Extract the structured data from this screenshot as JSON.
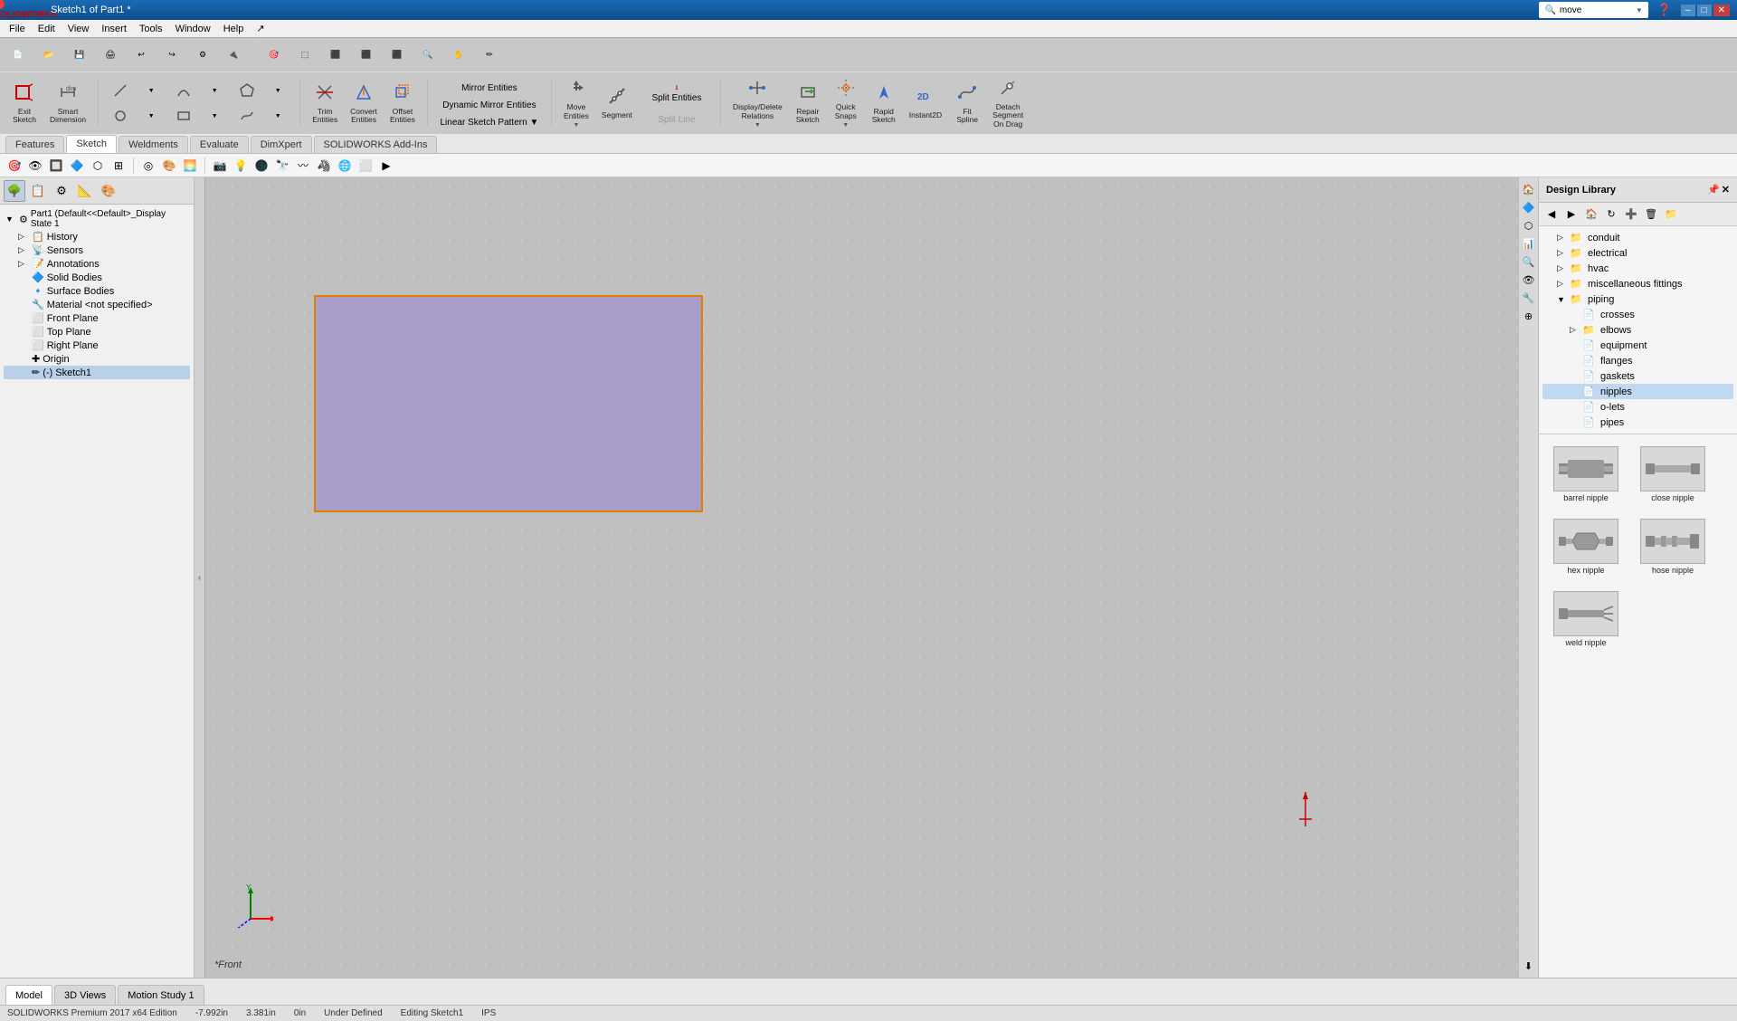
{
  "titlebar": {
    "logo": "SW",
    "title": "Sketch1 of Part1 *",
    "search_placeholder": "move",
    "controls": [
      "–",
      "□",
      "✕"
    ]
  },
  "menubar": {
    "items": [
      "File",
      "Edit",
      "View",
      "Insert",
      "Tools",
      "Window",
      "Help",
      "↗"
    ]
  },
  "toolbar": {
    "row1_icons": [
      "new",
      "open",
      "save",
      "print",
      "undo",
      "redo",
      "options"
    ],
    "sketch_tools": {
      "exit_sketch": "Exit\nSketch",
      "smart_dimension": "Smart\nDimension",
      "trim_entities": "Trim\nEntities",
      "convert_entities": "Convert\nEntities",
      "offset_entities": "Offset\nEntities",
      "mirror_entities": "Mirror Entities",
      "dynamic_mirror": "Dynamic Mirror Entities",
      "linear_pattern": "Linear Sketch Pattern",
      "move_entities": "Move Entities",
      "segment": "Segment",
      "split_line": "Split Line",
      "split_entities": "Split Entities",
      "display_delete": "Display/Delete\nRelations",
      "repair_sketch": "Repair\nSketch",
      "quick_snaps": "Quick\nSnaps",
      "rapid_sketch": "Rapid\nSketch",
      "instant2d": "Instant2D",
      "fit_spline": "Fit\nSpline",
      "detach_segment": "Detach\nSegment\nOn Drag"
    }
  },
  "tabs": {
    "items": [
      "Features",
      "Sketch",
      "Weldments",
      "Evaluate",
      "DimXpert",
      "SOLIDWORKS Add-Ins"
    ]
  },
  "left_panel": {
    "tab_icons": [
      "tree",
      "props",
      "config",
      "display",
      "appear"
    ],
    "tree": {
      "root": "Part1 (Default<<Default>_Display State 1",
      "items": [
        {
          "level": 1,
          "icon": "📋",
          "label": "History",
          "expand": false
        },
        {
          "level": 1,
          "icon": "📡",
          "label": "Sensors",
          "expand": false
        },
        {
          "level": 1,
          "icon": "📝",
          "label": "Annotations",
          "expand": true
        },
        {
          "level": 1,
          "icon": "🔷",
          "label": "Solid Bodies",
          "expand": false
        },
        {
          "level": 1,
          "icon": "🔹",
          "label": "Surface Bodies",
          "expand": false
        },
        {
          "level": 1,
          "icon": "🔧",
          "label": "Material <not specified>",
          "expand": false
        },
        {
          "level": 1,
          "icon": "⬜",
          "label": "Front Plane",
          "expand": false
        },
        {
          "level": 1,
          "icon": "⬜",
          "label": "Top Plane",
          "expand": false
        },
        {
          "level": 1,
          "icon": "⬜",
          "label": "Right Plane",
          "expand": false
        },
        {
          "level": 1,
          "icon": "✚",
          "label": "Origin",
          "expand": false
        },
        {
          "level": 1,
          "icon": "✏",
          "label": "(-) Sketch1",
          "expand": false,
          "selected": true
        }
      ]
    }
  },
  "canvas": {
    "view_label": "*Front",
    "sketch_color": "rgba(150, 130, 210, 0.55)",
    "border_color": "#e08000"
  },
  "right_panel": {
    "title": "Design Library",
    "tree": {
      "items": [
        {
          "label": "conduit",
          "icon": "📁",
          "expand": false,
          "indent": 1
        },
        {
          "label": "electrical",
          "icon": "📁",
          "expand": false,
          "indent": 1
        },
        {
          "label": "hvac",
          "icon": "📁",
          "expand": false,
          "indent": 1
        },
        {
          "label": "miscellaneous fittings",
          "icon": "📁",
          "expand": false,
          "indent": 1
        },
        {
          "label": "piping",
          "icon": "📁",
          "expand": true,
          "indent": 1
        },
        {
          "label": "crosses",
          "icon": "📄",
          "expand": false,
          "indent": 2
        },
        {
          "label": "elbows",
          "icon": "📁",
          "expand": false,
          "indent": 2
        },
        {
          "label": "equipment",
          "icon": "📄",
          "expand": false,
          "indent": 2
        },
        {
          "label": "flanges",
          "icon": "📄",
          "expand": false,
          "indent": 2
        },
        {
          "label": "gaskets",
          "icon": "📄",
          "expand": false,
          "indent": 2
        },
        {
          "label": "nipples",
          "icon": "📄",
          "expand": false,
          "indent": 2,
          "selected": true
        },
        {
          "label": "o-lets",
          "icon": "📄",
          "expand": false,
          "indent": 2
        },
        {
          "label": "pipes",
          "icon": "📄",
          "expand": false,
          "indent": 2
        }
      ]
    },
    "thumbnails": [
      {
        "label": "barrel nipple",
        "shape": "barrel"
      },
      {
        "label": "close nipple",
        "shape": "close"
      },
      {
        "label": "hex nipple",
        "shape": "hex"
      },
      {
        "label": "hose nipple",
        "shape": "hose"
      },
      {
        "label": "weld nipple",
        "shape": "weld"
      }
    ]
  },
  "statusbar": {
    "coords": "-7.992in",
    "y_coord": "3.381in",
    "z_coord": "0in",
    "status": "Under Defined",
    "editing": "Editing Sketch1",
    "units": "IPS",
    "company": "SOLIDWORKS Premium 2017 x64 Edition"
  },
  "bottom_tabs": [
    "Model",
    "3D Views",
    "Motion Study 1"
  ]
}
